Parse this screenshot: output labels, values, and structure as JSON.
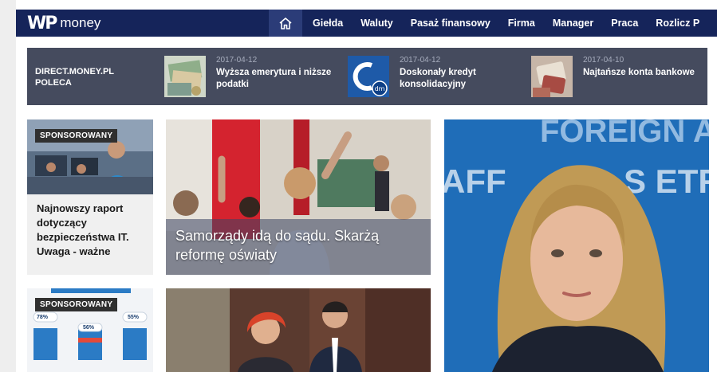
{
  "header": {
    "logo_mark": "WP",
    "logo_text": "money",
    "home_icon": "home-icon",
    "nav": [
      "Giełda",
      "Waluty",
      "Pasaż finansowy",
      "Firma",
      "Manager",
      "Praca",
      "Rozlicz P"
    ]
  },
  "partner": {
    "label": "DIRECT.MONEY.PL POLECA",
    "items": [
      {
        "date": "2017-04-12",
        "title": "Wyższa emerytura i niższe podatki"
      },
      {
        "date": "2017-04-12",
        "title": "Doskonały kredyt konsolidacyjny"
      },
      {
        "date": "2017-04-10",
        "title": "Najtańsze konta bankowe"
      }
    ]
  },
  "tiles": {
    "sponsored_label": "SPONSOROWANY",
    "sponsored_1_text": "Najnowszy raport dotyczący bezpieczeństwa IT. Uwaga - ważne",
    "school_headline": "Samorządy idą do sądu. Skarżą reformę oświaty",
    "portrait_banner": "FOREIGN AFFAIRS ETR",
    "sponsored_2_stats": [
      "78%",
      "56%",
      "55%"
    ]
  },
  "colors": {
    "nav_bg": "#15245a",
    "partner_bg": "#454b5e",
    "badge_bg": "#303030"
  }
}
